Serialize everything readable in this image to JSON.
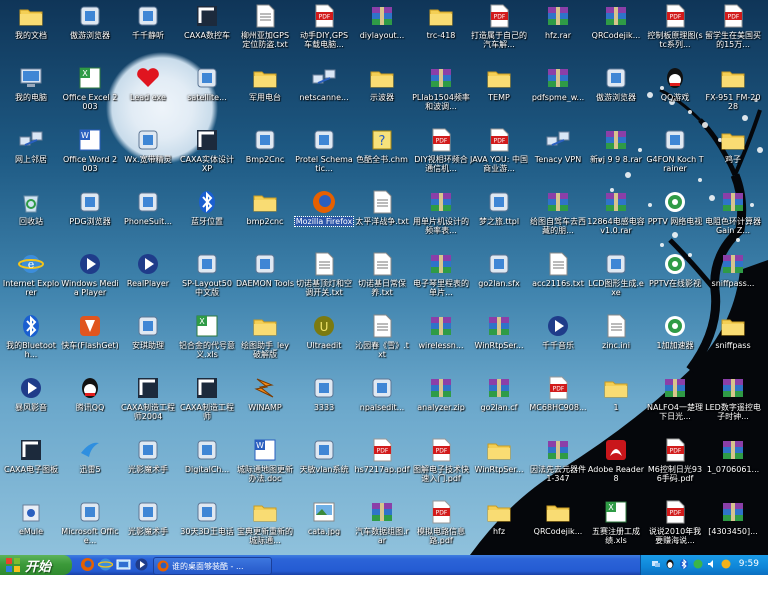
{
  "icons": [
    [
      "c1",
      "我的文档",
      "folder-docs-icon"
    ],
    [
      "c1",
      "我的电脑",
      "my-computer-icon"
    ],
    [
      "c1",
      "网上邻居",
      "network-icon"
    ],
    [
      "c1",
      "回收站",
      "recycle-bin-icon"
    ],
    [
      "c1",
      "Internet Explorer",
      "ie-icon"
    ],
    [
      "c1",
      "我的Bluetooth...",
      "bluetooth-icon"
    ],
    [
      "c1",
      "暴风影音",
      "storm-player-icon"
    ],
    [
      "c1",
      "CAXA电子图板",
      "caxa-draft-icon"
    ],
    [
      "c1",
      "eMule",
      "emule-icon"
    ],
    [
      "c2",
      "傲游浏览器",
      "maxthon-icon"
    ],
    [
      "c2",
      "Office Excel 2003",
      "excel-icon"
    ],
    [
      "c2",
      "Office Word 2003",
      "word-icon"
    ],
    [
      "c2",
      "PDG浏览器",
      "pdg-reader-icon"
    ],
    [
      "c2",
      "Windows Media Player",
      "wmp-icon"
    ],
    [
      "c2",
      "快车(FlashGet)",
      "flashget-icon"
    ],
    [
      "c2",
      "腾讯QQ",
      "qq-icon"
    ],
    [
      "c2",
      "迅雷5",
      "thunder-icon"
    ],
    [
      "c2",
      "Microsoft Office...",
      "office-icon"
    ],
    [
      "c3",
      "千千静听",
      "ttplayer-icon"
    ],
    [
      "c3",
      "Lead exe",
      "heart-icon"
    ],
    [
      "c3",
      "Wx.宽带精灵",
      "broadband-icon"
    ],
    [
      "c3",
      "PhoneSuit...",
      "phone-suite-icon"
    ],
    [
      "c3",
      "RealPlayer",
      "realplayer-icon"
    ],
    [
      "c3",
      "安琪助理",
      "assistant-icon"
    ],
    [
      "c3",
      "CAXA制造工程师2004",
      "caxa-me-icon"
    ],
    [
      "c3",
      "光影魔术手",
      "nikon-icon"
    ],
    [
      "c3",
      "光影魔术手",
      "magic-hand-icon"
    ],
    [
      "c4",
      "CAXA数控车",
      "caxa-lathe-icon"
    ],
    [
      "c4",
      "satellite...",
      "satellite-icon"
    ],
    [
      "c4",
      "CAXA实体设计 XP",
      "caxa-solid-icon"
    ],
    [
      "c4",
      "蓝牙位置",
      "bluetooth-place-icon"
    ],
    [
      "c4",
      "SP-Layout50 中文版",
      "sp-layout-icon"
    ],
    [
      "c4",
      "铝合金的代号意义.xls",
      "excel-file-icon"
    ],
    [
      "c4",
      "CAXA制造工程师",
      "caxa-me2-icon"
    ],
    [
      "c4",
      "DigitalCh...",
      "digital-icon"
    ],
    [
      "c4",
      "30天3D王电话",
      "phone-icon"
    ],
    [
      "c5",
      "柳州亚加GPS 定位防盗.txt",
      "text-file-icon"
    ],
    [
      "c5",
      "军用电台",
      "folder-icon"
    ],
    [
      "c5",
      "Bmp2Cnc",
      "bmp2cnc-icon"
    ],
    [
      "c5",
      "bmp2cnc",
      "folder-icon"
    ],
    [
      "c5",
      "DAEMON Tools",
      "daemon-icon"
    ],
    [
      "c5",
      "绘图助手_ley 破解版",
      "folder-icon"
    ],
    [
      "c5",
      "WINAMP",
      "winamp-icon"
    ],
    [
      "c5",
      "城际通地图更新办法.doc",
      "word-doc-icon"
    ],
    [
      "c5",
      "宝典更新重新的城际通...",
      "folder-icon"
    ],
    [
      "c6",
      "动手DIY,GPS 车载电脑...",
      "pdf-icon"
    ],
    [
      "c6",
      "netscanne...",
      "netscanner-icon"
    ],
    [
      "c6",
      "Protel Schematic...",
      "protel-icon"
    ],
    [
      "c6",
      "Mozilla Firefox",
      "firefox-icon"
    ],
    [
      "c6",
      "切诺基顶灯和空调开关.txt",
      "text-file-icon"
    ],
    [
      "c6",
      "Ultraedit",
      "ultraedit-icon"
    ],
    [
      "c6",
      "3333",
      "config-icon"
    ],
    [
      "c6",
      "天敏vlan系统",
      "vlan-icon"
    ],
    [
      "c6",
      "cata.jpg",
      "image-file-icon"
    ],
    [
      "c7",
      "diylayout...",
      "winrar-icon"
    ],
    [
      "c7",
      "示波器",
      "folder-icon"
    ],
    [
      "c7",
      "色酷全书.chm",
      "chm-icon"
    ],
    [
      "c7",
      "太平洋战争.txt",
      "text-file-icon"
    ],
    [
      "c7",
      "切诺基日常保养.txt",
      "text-file-icon"
    ],
    [
      "c7",
      "沁园春《雪》.txt",
      "text-file-icon"
    ],
    [
      "c7",
      "npalsedit...",
      "npalsedit-icon"
    ],
    [
      "c7",
      "hs7217ap.pdf",
      "pdf-icon"
    ],
    [
      "c7",
      "汽车数据组图.rar",
      "winrar-icon"
    ],
    [
      "c8",
      "trc-418",
      "folder-icon"
    ],
    [
      "c8",
      "PLlab1504频率和波调...",
      "winrar-icon"
    ],
    [
      "c8",
      "DIY视相环频合通信机...",
      "pdf-icon"
    ],
    [
      "c8",
      "用单片机设计的频率表...",
      "winrar-icon"
    ],
    [
      "c8",
      "电子琴里程表的单片...",
      "winrar-icon"
    ],
    [
      "c8",
      "wirelessn...",
      "winrar-icon"
    ],
    [
      "c8",
      "analyzer.zip",
      "winrar-icon"
    ],
    [
      "c8",
      "图解电子技术快速入门.pdf",
      "pdf-icon"
    ],
    [
      "c8",
      "模拟电路信息路.pdf",
      "pdf-icon"
    ],
    [
      "c9",
      "打造属于自己的汽车解...",
      "pdf-icon"
    ],
    [
      "c9",
      "TEMP",
      "folder-icon"
    ],
    [
      "c9",
      "JAVA YOU: 中国商业游...",
      "pdf-icon"
    ],
    [
      "c9",
      "梦之旅.ttpl",
      "ttpl-icon"
    ],
    [
      "c9",
      "go2lan.sfx",
      "go2lan-icon"
    ],
    [
      "c9",
      "WinRtpSer...",
      "winrar-icon"
    ],
    [
      "c9",
      "go2lan.cf",
      "winrar-icon"
    ],
    [
      "c9",
      "WinRtpSer...",
      "folder-icon"
    ],
    [
      "c9",
      "hfz",
      "folder-icon"
    ],
    [
      "c10",
      "hfz.rar",
      "winrar-icon"
    ],
    [
      "c10",
      "pdfspme_w...",
      "winrar-icon"
    ],
    [
      "c10",
      "Tenacy VPN",
      "vpn-icon"
    ],
    [
      "c10",
      "给图自驾车去西藏的朋...",
      "winrar-icon"
    ],
    [
      "c10",
      "acc2116s.txt",
      "text-file-icon"
    ],
    [
      "c10",
      "千千音乐",
      "music-icon"
    ],
    [
      "c10",
      "MC68HC908...",
      "pdf-icon"
    ],
    [
      "c10",
      "因法先去元器件1-347",
      "winrar-icon"
    ],
    [
      "c10",
      "QRCodejik...",
      "folder-icon"
    ],
    [
      "c11",
      "QRCodejik...",
      "winrar-icon"
    ],
    [
      "c11",
      "傲游浏览器",
      "maxthon2-icon"
    ],
    [
      "c11",
      "新vj 9 9 8.rar",
      "winrar-icon"
    ],
    [
      "c11",
      "12864电感电容v1.0.rar",
      "winrar-icon"
    ],
    [
      "c11",
      "LCD图形生成.exe",
      "lcd-tool-icon"
    ],
    [
      "c11",
      "zinc.ini",
      "ini-file-icon"
    ],
    [
      "c11",
      "1",
      "folder-icon"
    ],
    [
      "c11",
      "Adobe Reader 8",
      "adobe-reader-icon"
    ],
    [
      "c11",
      "五赛注册工成绩.xls",
      "excel-file-icon"
    ],
    [
      "c12",
      "控制板原理图(stc系列...",
      "pdf-icon"
    ],
    [
      "c12",
      "QQ游戏",
      "qq-game-icon"
    ],
    [
      "c12",
      "G4FON Koch Trainer",
      "g4fon-icon"
    ],
    [
      "c12",
      "PPTV 网络电视",
      "pptv-icon"
    ],
    [
      "c12",
      "PPTV在线影视",
      "pptv2-icon"
    ],
    [
      "c12",
      "1加加速器",
      "accelerator-icon"
    ],
    [
      "c12",
      "NALFO4一楚理下日光...",
      "winrar-icon"
    ],
    [
      "c12",
      "M6控制日光936手码.pdf",
      "pdf-icon"
    ],
    [
      "c12",
      "说说2010年我要赚海说...",
      "pdf-icon"
    ],
    [
      "c13",
      "留学生在美国买的15万...",
      "pdf-icon"
    ],
    [
      "c13",
      "FX-951 FM-2028",
      "folder-icon"
    ],
    [
      "c13",
      "鸡子",
      "folder-icon"
    ],
    [
      "c13",
      "电阻色环计算器Gain Z...",
      "winrar-icon"
    ],
    [
      "c13",
      "sniffpass...",
      "winrar-icon"
    ],
    [
      "c13",
      "sniffpass",
      "folder-icon"
    ],
    [
      "c13",
      "LED数字遥控电子时钟...",
      "winrar-icon"
    ],
    [
      "c13",
      "1_0706061...",
      "winrar-icon"
    ],
    [
      "c13",
      "[4303450]...",
      "winrar-icon"
    ]
  ],
  "taskbar": {
    "start_label": "开始",
    "task_label": "谁的桌面够装酷 - ...",
    "clock": "9:59"
  },
  "colors": {
    "taskbar": "#245bd2",
    "start": "#3c9a3a",
    "tray": "#0f86d8"
  }
}
